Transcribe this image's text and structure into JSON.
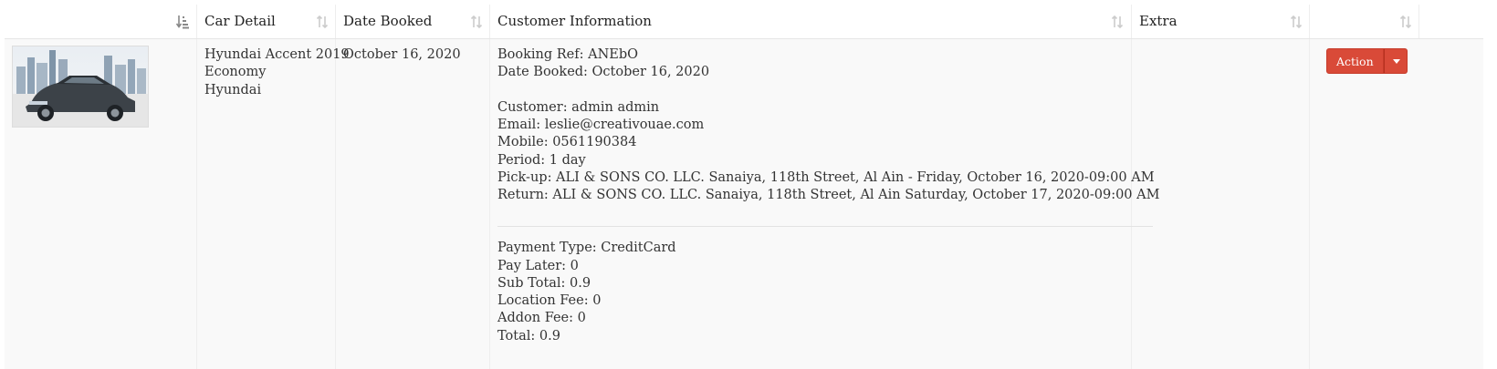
{
  "header": {
    "columns": [
      {
        "label": ""
      },
      {
        "label": "Car Detail"
      },
      {
        "label": "Date Booked"
      },
      {
        "label": "Customer Information"
      },
      {
        "label": "Extra"
      },
      {
        "label": ""
      }
    ],
    "sort_icons": [
      "sort-amount-icon",
      "sort-icon",
      "sort-icon",
      "sort-icon",
      "sort-icon",
      "sort-icon"
    ]
  },
  "row": {
    "image_alt": "Hyundai car photo",
    "car": {
      "line1": "Hyundai Accent 2019",
      "line2": "Economy",
      "line3": "Hyundai"
    },
    "date_booked": "October 16, 2020",
    "customer_info": {
      "booking_ref": "Booking Ref: ANEbO",
      "date_booked": "Date Booked: October 16, 2020",
      "customer": "Customer: admin admin",
      "email": "Email: leslie@creativouae.com",
      "mobile": "Mobile: 0561190384",
      "period": "Period: 1 day",
      "pickup": "Pick-up: ALI & SONS CO. LLC. Sanaiya, 118th Street, Al Ain - Friday, October 16, 2020-09:00 AM",
      "return": "Return: ALI & SONS CO. LLC. Sanaiya, 118th Street, Al Ain Saturday, October 17, 2020-09:00 AM",
      "payment_type": "Payment Type: CreditCard",
      "pay_later": "Pay Later: 0",
      "sub_total": "Sub Total: 0.9",
      "location_fee": "Location Fee: 0",
      "addon_fee": "Addon Fee: 0",
      "total": "Total: 0.9"
    },
    "extra": "",
    "action_label": "Action"
  },
  "colors": {
    "action_button": "#d94a38",
    "row_background": "#f9f9f9"
  }
}
